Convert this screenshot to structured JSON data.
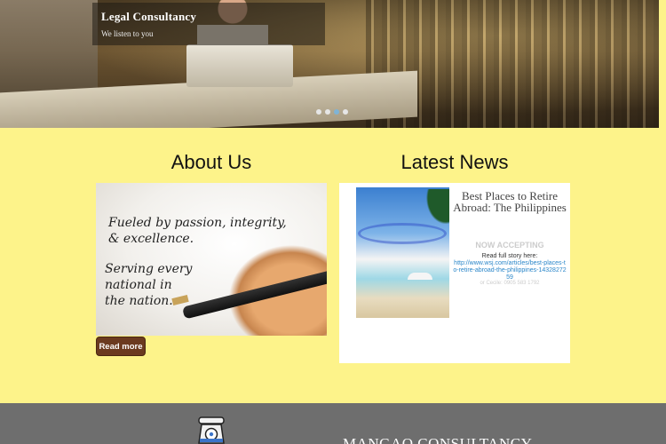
{
  "hero": {
    "caption_title": "Legal Consultancy",
    "caption_subtitle": "We listen to you",
    "slide_dots": 4,
    "active_dot": 3
  },
  "about": {
    "title": "About Us",
    "image_text_line1": "Fueled by passion, integrity,",
    "image_text_line2": "& excellence.",
    "image_text_line3": "Serving every",
    "image_text_line4": "national in",
    "image_text_line5": "the nation.",
    "read_more_label": "Read more"
  },
  "news": {
    "title": "Latest News",
    "headline": "Best Places to Retire Abroad: The Philippines",
    "ghost_text": "NOW ACCEPTING",
    "read_full": "Read full story here:",
    "link": "http://www.wsj.com/articles/best-places-to-retire-abroad-the-philippines-1432827259",
    "ghost_text2": "or Cecile: 0905 583 1792"
  },
  "footer": {
    "brand": "MANGAO CONSULTANCY"
  },
  "colors": {
    "page_bg": "#fdf38a",
    "footer_bg": "#6e6e6e",
    "read_more_bg": "#6b3a1f",
    "link": "#2a86c9",
    "active_dot": "#7fb4d6"
  }
}
